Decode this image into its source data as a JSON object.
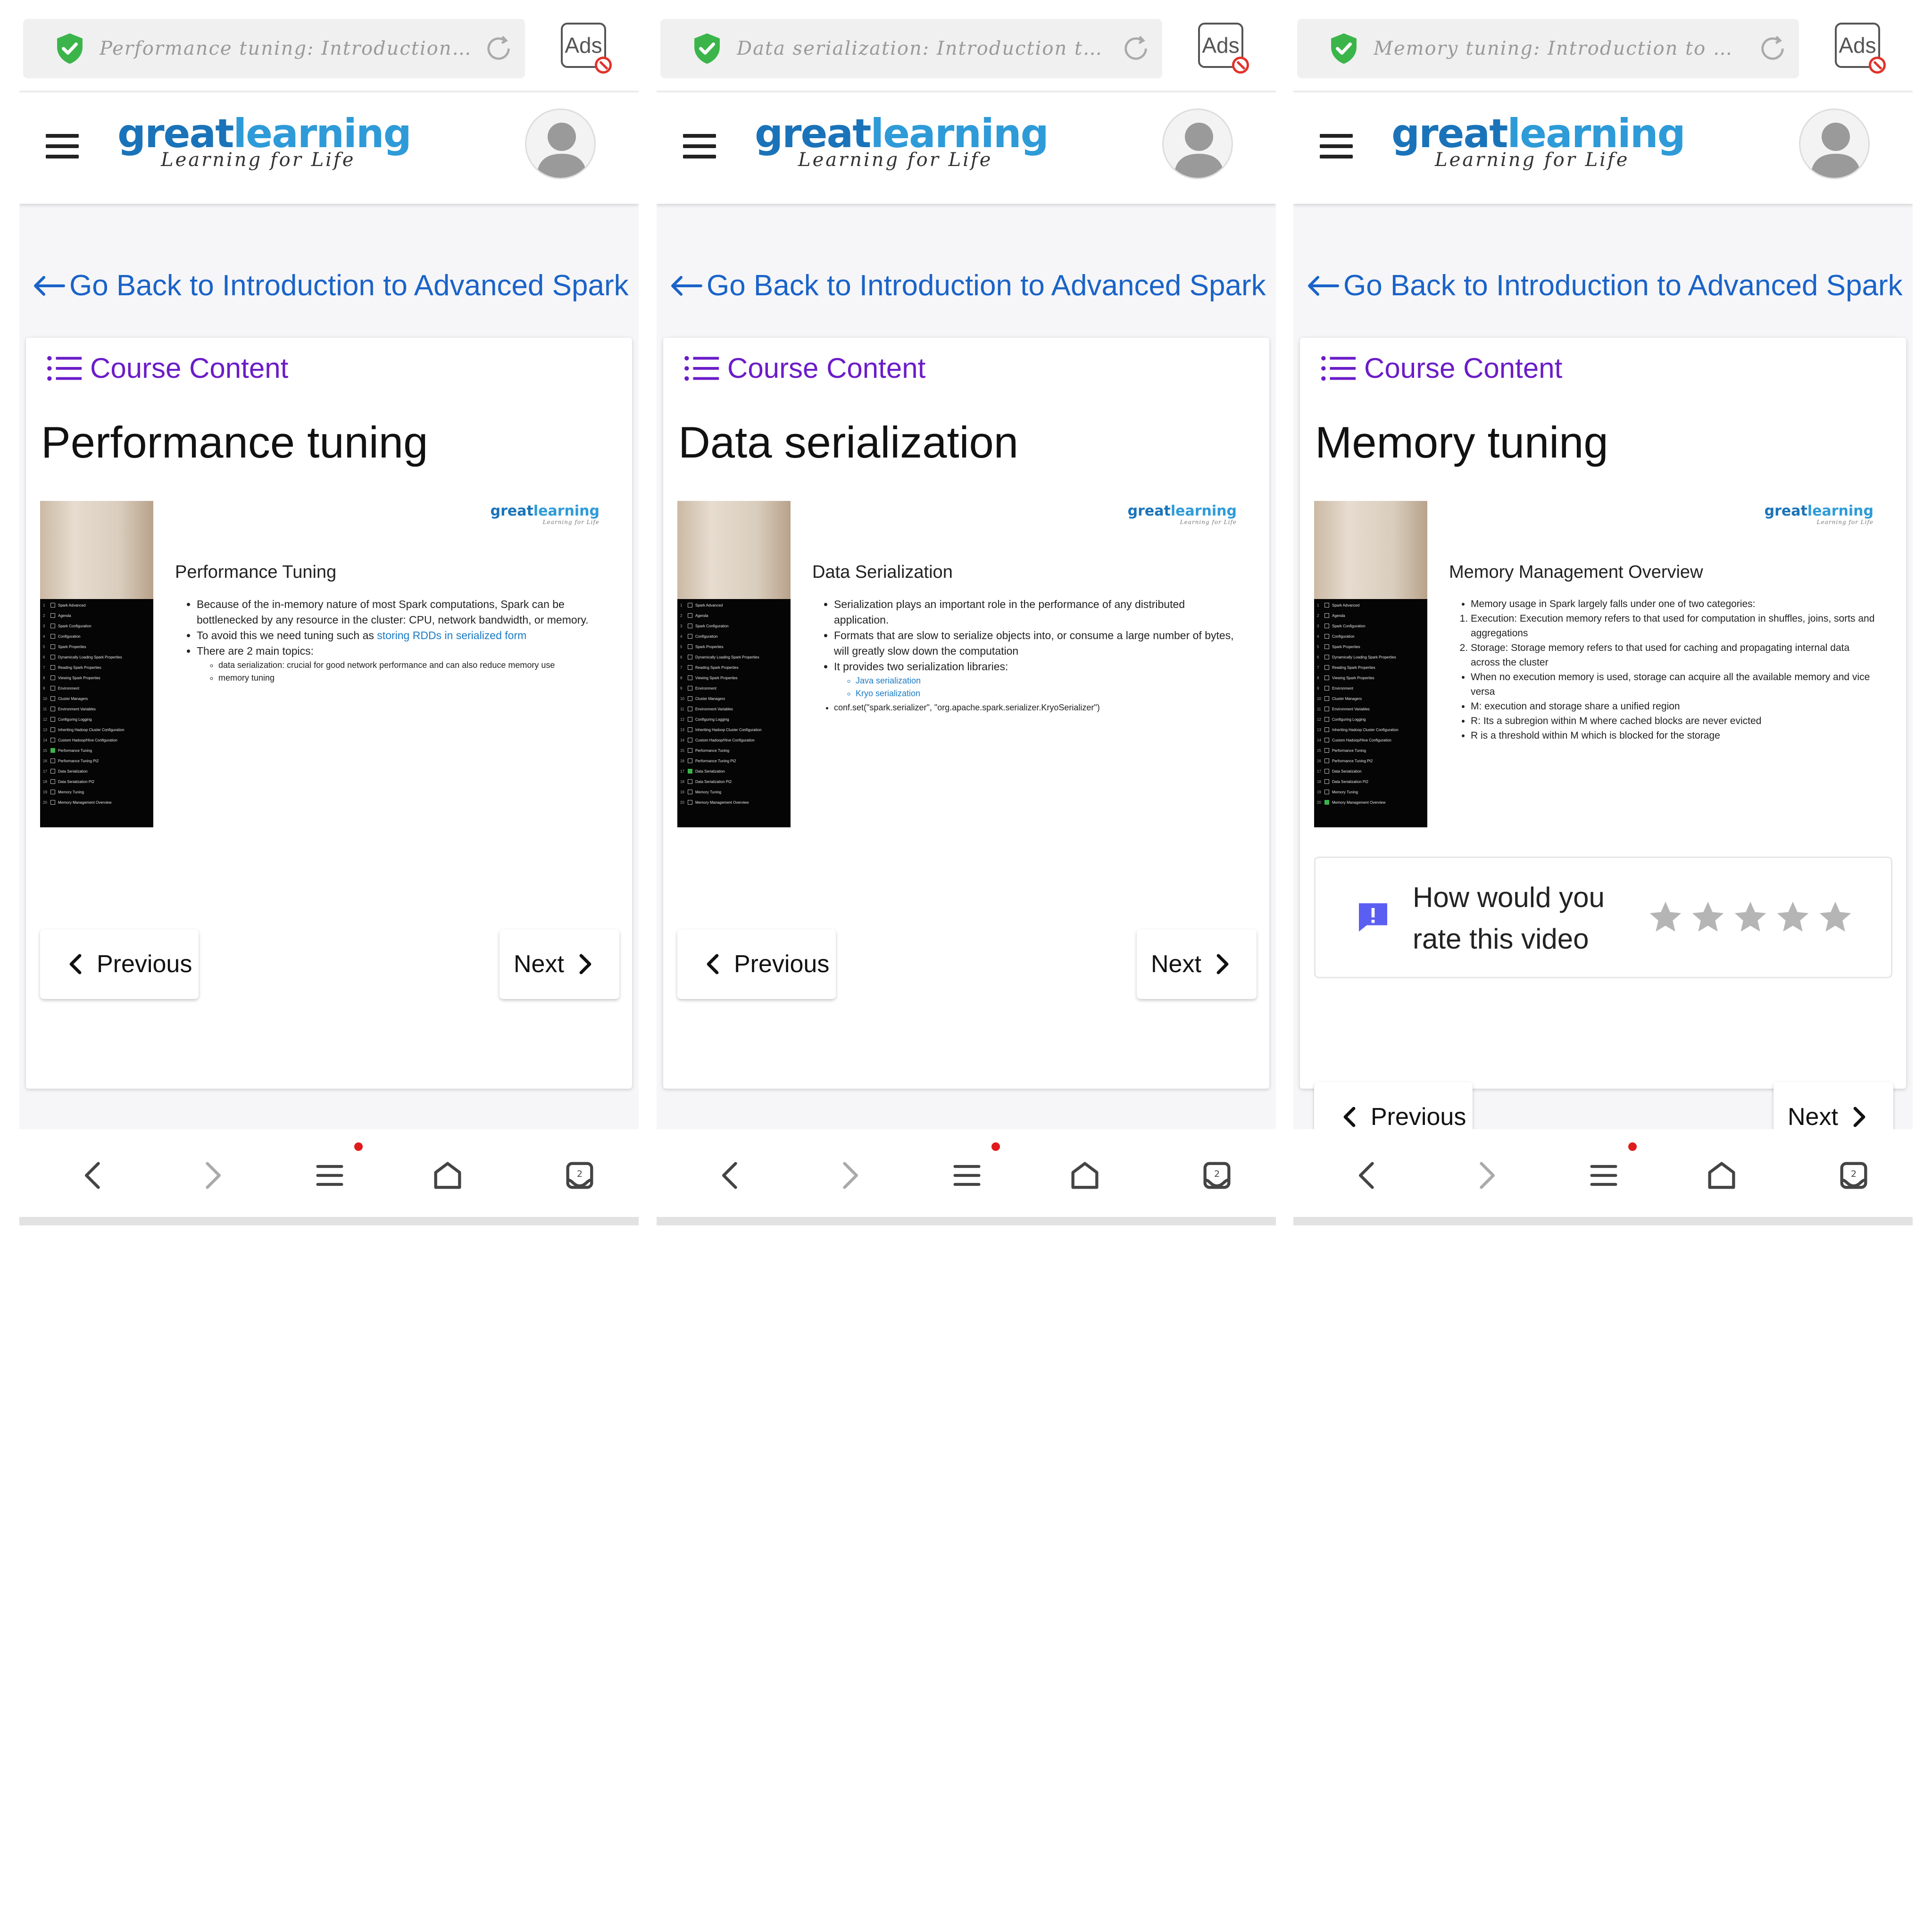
{
  "common": {
    "ads_label": "Ads",
    "brand": {
      "great": "great",
      "learning": "learning",
      "tagline": "Learning for Life"
    },
    "back_link": "Go Back to Introduction to Advanced Spark",
    "course_content": "Course Content",
    "previous_label": "Previous",
    "next_label": "Next",
    "video_logo": {
      "great": "great",
      "learning": "learning",
      "tagline": "Learning for Life"
    },
    "toc": [
      {
        "n": "1",
        "t": "Spark Advanced"
      },
      {
        "n": "2",
        "t": "Agenda"
      },
      {
        "n": "3",
        "t": "Spark Configuration"
      },
      {
        "n": "4",
        "t": "Configuration"
      },
      {
        "n": "5",
        "t": "Spark Properties"
      },
      {
        "n": "6",
        "t": "Dynamically Loading Spark Properties"
      },
      {
        "n": "7",
        "t": "Reading Spark Properties"
      },
      {
        "n": "8",
        "t": "Viewing Spark Properties"
      },
      {
        "n": "9",
        "t": "Environment"
      },
      {
        "n": "10",
        "t": "Cluster Managers"
      },
      {
        "n": "11",
        "t": "Environment Variables"
      },
      {
        "n": "12",
        "t": "Configuring Logging"
      },
      {
        "n": "13",
        "t": "Inheriting Hadoop Cluster Configuration"
      },
      {
        "n": "14",
        "t": "Custom Hadoop/Hive Configuration"
      },
      {
        "n": "15",
        "t": "Performance Tuning"
      },
      {
        "n": "16",
        "t": "Performance Tuning Pt2"
      },
      {
        "n": "17",
        "t": "Data Serialization"
      },
      {
        "n": "18",
        "t": "Data Serialization Pt2"
      },
      {
        "n": "19",
        "t": "Memory Tuning"
      },
      {
        "n": "20",
        "t": "Memory Management Overview"
      }
    ]
  },
  "phones": [
    {
      "url": "Performance tuning: Introduction to A...",
      "title": "Performance tuning",
      "toc_checked": 14,
      "slide_title": "Performance Tuning",
      "bullets": [
        "Because of the in-memory nature of most Spark computations, Spark can be bottlenecked by any resource in the cluster: CPU, network bandwidth, or memory.",
        "To avoid this we need tuning such as ",
        "There are 2 main topics:"
      ],
      "bullet_link": "storing RDDs in serialized form",
      "sub_bullets": [
        "data serialization: crucial for good network performance and can also reduce memory use",
        "memory tuning"
      ]
    },
    {
      "url": "Data serialization: Introduction to A...",
      "title": "Data serialization",
      "toc_checked": 16,
      "slide_title": "Data Serialization",
      "bullets": [
        "Serialization plays an important role in the performance of any distributed application.",
        "Formats that are slow to serialize objects into, or consume a large number of bytes, will greatly slow down the computation",
        "It provides two serialization libraries:",
        "conf.set(\"spark.serializer\", \"org.apache.spark.serializer.KryoSerializer\")"
      ],
      "sub_links": [
        "Java serialization",
        "Kryo serialization"
      ]
    },
    {
      "url": "Memory tuning: Introduction to Advan...",
      "title": "Memory tuning",
      "toc_checked": 19,
      "slide_title": "Memory Management Overview",
      "bullets_top": [
        "Memory usage in Spark largely falls under one of two categories:"
      ],
      "numbered": [
        "Execution: Execution memory refers to that used for computation in shuffles, joins, sorts and aggregations",
        "Storage: Storage memory refers to that used for caching and propagating internal data across the cluster"
      ],
      "bullets_bottom": [
        "When no execution memory is used, storage can acquire all the available memory and vice versa",
        "M: execution and storage share a unified region",
        "R: Its a subregion within M where cached blocks are never evicted",
        "R is a threshold within M which is blocked for the storage"
      ],
      "rating_prompt": "How would you rate this video",
      "rating_stars": 5
    }
  ],
  "colors": {
    "link": "#1a63c8",
    "purple": "#6b1cc8",
    "shield": "#3bb54a"
  },
  "icons": [
    "shield-check-icon",
    "reload-icon",
    "ads-block-icon",
    "hamburger-icon",
    "avatar-icon",
    "back-arrow-icon",
    "list-icon",
    "feedback-icon",
    "star-icon",
    "chevron-left-icon",
    "chevron-right-icon",
    "nav-back-icon",
    "nav-forward-icon",
    "nav-menu-icon",
    "nav-home-icon",
    "nav-tabs-icon"
  ]
}
